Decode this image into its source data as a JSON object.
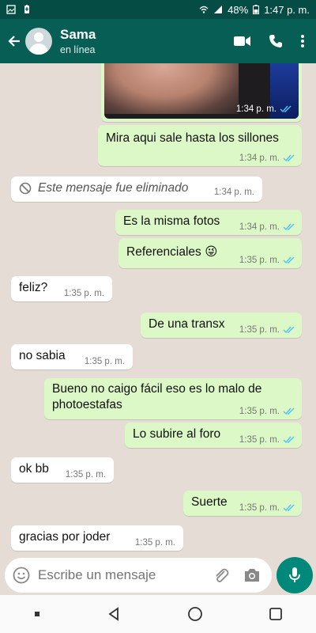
{
  "status_bar": {
    "battery": "48%",
    "time": "1:47 p. m."
  },
  "header": {
    "contact_name": "Sama",
    "contact_status": "en línea"
  },
  "image_message": {
    "time": "1:34 p. m."
  },
  "messages": [
    {
      "text": "Mira aqui sale hasta los sillones",
      "time": "1:34 p. m."
    },
    {
      "text": "Este mensaje fue eliminado",
      "time": "1:34 p. m."
    },
    {
      "text": "Es la misma fotos",
      "time": "1:34 p. m."
    },
    {
      "text": "Referenciales",
      "emoji": "😜",
      "time": "1:35 p. m."
    },
    {
      "text": "feliz?",
      "time": "1:35 p. m."
    },
    {
      "text": "De una transx",
      "time": "1:35 p. m."
    },
    {
      "text": "no sabia",
      "time": "1:35 p. m."
    },
    {
      "line1": "Bueno no caigo fácil eso es lo malo de",
      "line2": "photoestafas",
      "time": "1:35 p. m."
    },
    {
      "text": "Lo subire al foro",
      "time": "1:35 p. m."
    },
    {
      "text": "ok bb",
      "time": "1:35 p. m."
    },
    {
      "text": "Suerte",
      "time": "1:35 p. m."
    },
    {
      "text": "gracias por joder",
      "time": "1:35 p. m."
    }
  ],
  "composer": {
    "placeholder": "Escribe un mensaje"
  },
  "colors": {
    "header": "#075e54",
    "status_bar": "#054d44",
    "outgoing": "#dcf8c6",
    "incoming": "#ffffff",
    "background": "#e5ddd5",
    "ticks": "#4fc3f7",
    "fab": "#00897b"
  }
}
